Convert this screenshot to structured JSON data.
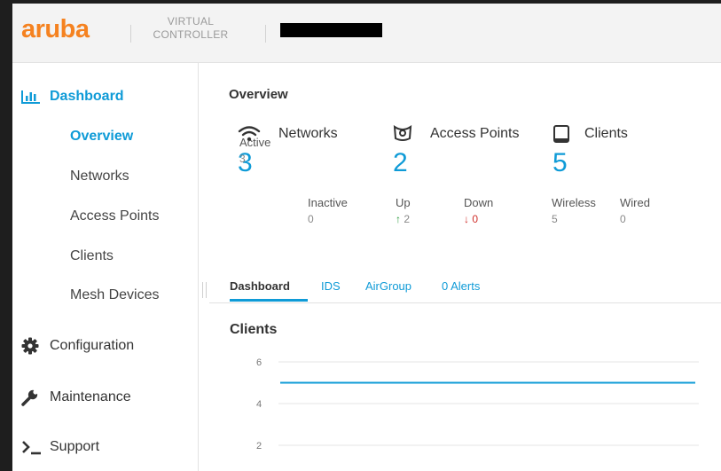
{
  "header": {
    "logo_text": "aruba",
    "product_line1": "VIRTUAL",
    "product_line2": "CONTROLLER"
  },
  "sidebar": {
    "dashboard": {
      "label": "Dashboard",
      "icon": "bar-chart-icon"
    },
    "sub_items": [
      {
        "label": "Overview",
        "active": true
      },
      {
        "label": "Networks"
      },
      {
        "label": "Access Points"
      },
      {
        "label": "Clients"
      },
      {
        "label": "Mesh Devices"
      }
    ],
    "configuration": {
      "label": "Configuration",
      "icon": "gear-icon"
    },
    "maintenance": {
      "label": "Maintenance",
      "icon": "wrench-icon"
    },
    "support": {
      "label": "Support",
      "icon": "terminal-icon"
    }
  },
  "overview": {
    "title": "Overview",
    "networks": {
      "label": "Networks",
      "count": "3",
      "active_label": "Active",
      "active": "3",
      "inactive_label": "Inactive",
      "inactive": "0"
    },
    "access_points": {
      "label": "Access Points",
      "count": "2",
      "up_label": "Up",
      "up": "2",
      "down_label": "Down",
      "down": "0"
    },
    "clients": {
      "label": "Clients",
      "count": "5",
      "wireless_label": "Wireless",
      "wireless": "5",
      "wired_label": "Wired",
      "wired": "0"
    }
  },
  "tabs": [
    {
      "label": "Dashboard",
      "active": true
    },
    {
      "label": "IDS"
    },
    {
      "label": "AirGroup"
    },
    {
      "label": "0 Alerts"
    }
  ],
  "clients_chart": {
    "title": "Clients"
  },
  "colors": {
    "accent": "#0f9bd7",
    "brand": "#f58220",
    "up": "#2e9b3f",
    "down": "#d0312d"
  },
  "chart_data": {
    "type": "line",
    "title": "Clients",
    "y_ticks": [
      6,
      4,
      2
    ],
    "ylim": [
      2,
      6
    ],
    "grid": true,
    "series": [
      {
        "values": [
          5,
          5
        ]
      }
    ]
  }
}
